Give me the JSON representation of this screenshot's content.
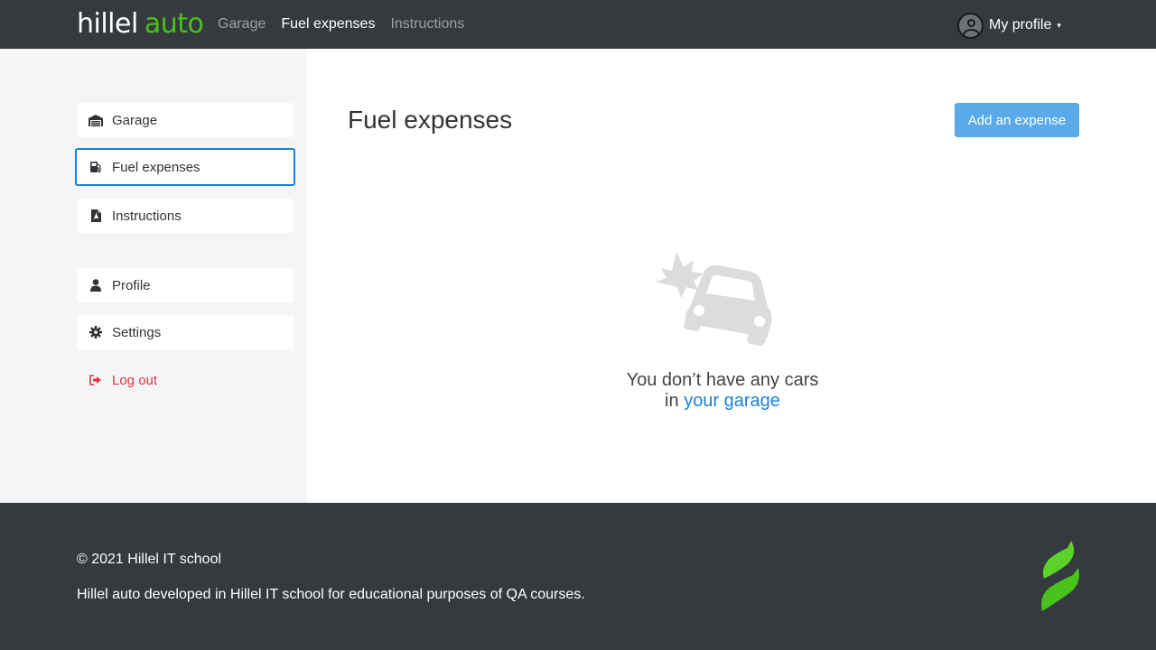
{
  "header": {
    "logo_part1": "hillel",
    "logo_part2": "auto",
    "nav": [
      {
        "label": "Garage",
        "active": false
      },
      {
        "label": "Fuel expenses",
        "active": true
      },
      {
        "label": "Instructions",
        "active": false
      }
    ],
    "profile_label": "My profile",
    "caret": "▾"
  },
  "sidebar": {
    "items": [
      {
        "label": "Garage",
        "icon": "garage-icon"
      },
      {
        "label": "Fuel expenses",
        "icon": "fuel-icon",
        "active": true
      },
      {
        "label": "Instructions",
        "icon": "pdf-icon"
      },
      {
        "label": "Profile",
        "icon": "user-icon"
      },
      {
        "label": "Settings",
        "icon": "gear-icon"
      },
      {
        "label": "Log out",
        "icon": "logout-icon"
      }
    ]
  },
  "main": {
    "title": "Fuel expenses",
    "add_button_label": "Add an expense",
    "empty_line1": "You don’t have any cars",
    "empty_prefix": "in",
    "empty_link": "your garage"
  },
  "footer": {
    "copyright": "© 2021 Hillel IT school",
    "description": "Hillel auto developed in Hillel IT school for educational purposes of QA courses."
  },
  "colors": {
    "header_bg": "#353a3e",
    "brand_green": "#47c31c",
    "accent_blue": "#1e7fd4",
    "button_blue": "#5aaaea",
    "danger_red": "#dc3545",
    "sidebar_bg": "#f5f5f8"
  }
}
